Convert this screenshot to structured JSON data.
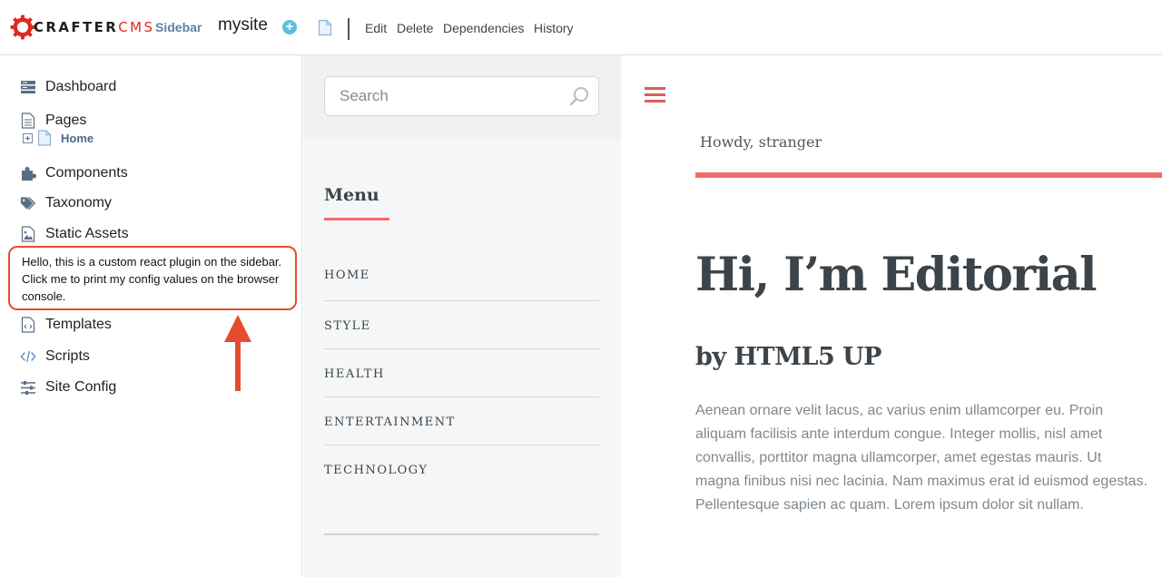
{
  "topbar": {
    "logo_part1": "CRAFTER",
    "logo_part2": "CMS",
    "sidebar_toggle": "Sidebar",
    "site_name": "mysite",
    "actions": [
      "Edit",
      "Delete",
      "Dependencies",
      "History"
    ]
  },
  "sidebar": {
    "items": [
      {
        "label": "Dashboard",
        "icon": "dashboard-icon"
      },
      {
        "label": "Pages",
        "icon": "pages-icon"
      },
      {
        "label": "Components",
        "icon": "puzzle-icon"
      },
      {
        "label": "Taxonomy",
        "icon": "tags-icon"
      },
      {
        "label": "Static Assets",
        "icon": "image-icon"
      },
      {
        "label": "Templates",
        "icon": "code-file-icon"
      },
      {
        "label": "Scripts",
        "icon": "code-icon"
      },
      {
        "label": "Site Config",
        "icon": "sliders-icon"
      }
    ],
    "tree_home": "Home",
    "plugin_text": "Hello, this is a custom react plugin on the sidebar. Click me to print my config values on the browser console."
  },
  "middle": {
    "search_placeholder": "Search",
    "menu_title": "Menu",
    "menu_items": [
      "HOME",
      "STYLE",
      "HEALTH",
      "ENTERTAINMENT",
      "TECHNOLOGY"
    ]
  },
  "preview": {
    "greeting": "Howdy, stranger",
    "title": "Hi, I’m Editorial",
    "subtitle": "by HTML5 UP",
    "body": "Aenean ornare velit lacus, ac varius enim ullamcorper eu. Proin aliquam facilisis ante interdum congue. Integer mollis, nisl amet convallis, porttitor magna ullamcorper, amet egestas mauris. Ut magna finibus nisi nec lacinia. Nam maximus erat id euismod egestas. Pellentesque sapien ac quam. Lorem ipsum dolor sit nullam."
  },
  "colors": {
    "brand_red": "#e02a1c",
    "accent": "#f56a6a",
    "link_blue": "#5f7fa6",
    "annotation_red": "#e54c2f"
  }
}
